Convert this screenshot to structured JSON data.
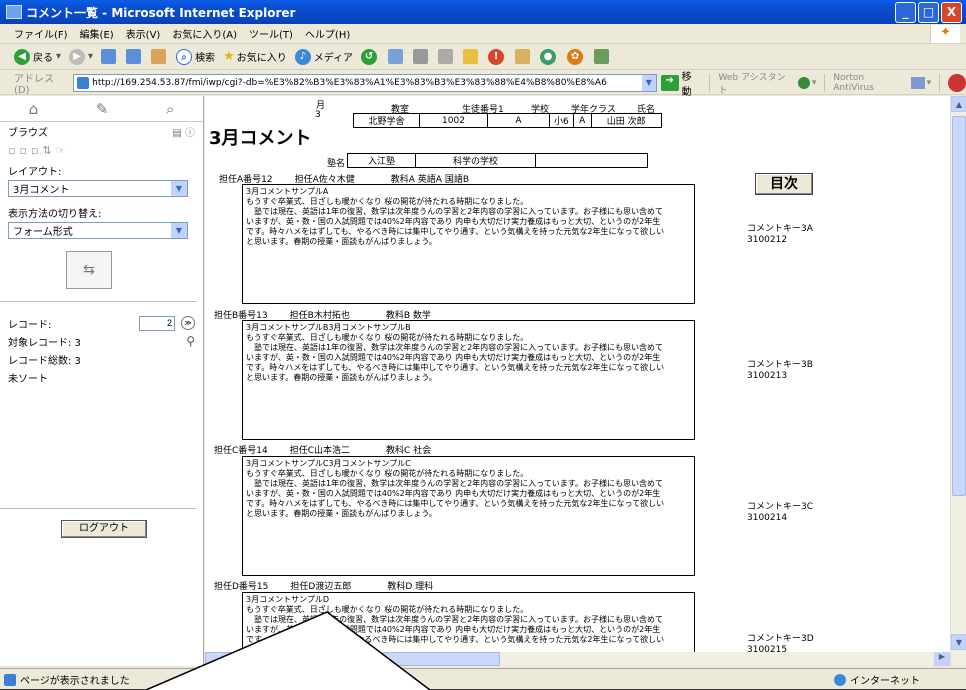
{
  "window": {
    "title": "コメント一覧 - Microsoft Internet Explorer",
    "minimize": "_",
    "maximize": "□",
    "close": "X"
  },
  "menu": [
    "ファイル(F)",
    "編集(E)",
    "表示(V)",
    "お気に入り(A)",
    "ツール(T)",
    "ヘルプ(H)"
  ],
  "toolbar": {
    "back": "戻る",
    "search": "検索",
    "favorites": "お気に入り",
    "media": "メディア"
  },
  "address": {
    "label": "アドレス(D)",
    "url": "http://169.254.53.87/fmi/iwp/cgi?-db=%E3%82%B3%E3%83%A1%E3%83%B3%E3%83%88%E4%B8%80%E8%A6",
    "go": "移動",
    "web_assistant": "Web アシスタント",
    "norton": "Norton AntiVirus"
  },
  "left": {
    "browse": "ブラウズ",
    "layout_label": "レイアウト:",
    "layout_value": "3月コメント",
    "view_label": "表示方法の切り替え:",
    "view_value": "フォーム形式",
    "record_label": "レコード:",
    "record_value": "2",
    "found_label": "対象レコード: 3",
    "total_label": "レコード総数: 3",
    "unsorted": "未ソート",
    "logout": "ログアウト"
  },
  "content": {
    "page_title": "3月コメント",
    "month_label": "月",
    "month_value": "3",
    "class_label": "教室",
    "class_value": "北野学舎",
    "student_no_label": "生徒番号1",
    "student_no_value": "1002",
    "school_label": "学校",
    "school_value": "A",
    "grade_class_label": "学年クラス",
    "grade_value": "小6",
    "class_letter": "A",
    "name_label": "氏名",
    "name_value": "山田 次郎",
    "juku_label": "塾名",
    "juku_value": "入江塾",
    "aim_value": "科学の学校",
    "toc": "目次"
  },
  "sections": [
    {
      "teacher_no": "担任A番号12",
      "teacher": "担任A佐々木健",
      "subject": "教科A 英語A 国語B",
      "comment": [
        "3月コメントサンプルA",
        "もうすぐ卒業式、日ざしも暖かくなり 桜の開花が待たれる時期になりました。",
        "　塾では現在、英語は1年の復習、数学は次年度うんの学習と2年内容の学習に入っています。お子様にも思い含めて",
        "いますが、英・数・国の入試問題では40%2年内容であり 内申も大切だけ実力養成はもっと大切、というのが2年生",
        "です。時々ハメをはずしても、やるべき時には集中してやり通す、という気構えを持った元気な2年生になって欲しい",
        "と思います。春期の授業・面談もがんばりましょう。"
      ],
      "key": "コメントキー3A",
      "key_no": "3100212"
    },
    {
      "teacher_no": "担任B番号13",
      "teacher": "担任B木村拓也",
      "subject": "教科B 数学",
      "comment": [
        "3月コメントサンプルB3月コメントサンプルB",
        "もうすぐ卒業式、日ざしも暖かくなり 桜の開花が待たれる時期になりました。",
        "　塾では現在、英語は1年の復習、数学は次年度うんの学習と2年内容の学習に入っています。お子様にも思い含めて",
        "いますが、英・数・国の入試問題では40%2年内容であり 内申も大切だけ実力養成はもっと大切、というのが2年生",
        "です。時々ハメをはずしても、やるべき時には集中してやり通す、という気構えを持った元気な2年生になって欲しい",
        "と思います。春期の授業・面談もがんばりましょう。"
      ],
      "key": "コメントキー3B",
      "key_no": "3100213"
    },
    {
      "teacher_no": "担任C番号14",
      "teacher": "担任C山本浩二",
      "subject": "教科C 社会",
      "comment": [
        "3月コメントサンプルC3月コメントサンプルC",
        "もうすぐ卒業式、日ざしも暖かくなり 桜の開花が待たれる時期になりました。",
        "　塾では現在、英語は1年の復習、数学は次年度うんの学習と2年内容の学習に入っています。お子様にも思い含めて",
        "いますが、英・数・国の入試問題では40%2年内容であり 内申も大切だけ実力養成はもっと大切、というのが2年生",
        "です。時々ハメをはずしても、やるべき時には集中してやり通す、という気構えを持った元気な2年生になって欲しい",
        "と思います。春期の授業・面談もがんばりましょう。"
      ],
      "key": "コメントキー3C",
      "key_no": "3100214"
    },
    {
      "teacher_no": "担任D番号15",
      "teacher": "担任D渡辺五郎",
      "subject": "教科D 理科",
      "comment": [
        "3月コメントサンプルD",
        "もうすぐ卒業式、日ざしも暖かくなり 桜の開花が待たれる時期になりました。",
        "　塾では現在、英語は1年の復習、数学は次年度うんの学習と2年内容の学習に入っています。お子様にも思い含めて",
        "いますが、英・数・国の入試問題では40%2年内容であり 内申も大切だけ実力養成はもっと大切、というのが2年生",
        "です。時々ハメをはずしても、やるべき時には集中してやり通す、という気構えを持った元気な2年生になって欲しい"
      ],
      "key": "コメントキー3D",
      "key_no": "3100215"
    }
  ],
  "status": {
    "text": "ページが表示されました",
    "zone": "インターネット"
  },
  "colors": {
    "titlebar": "#0a4fd0",
    "accent": "#c1d3fb"
  }
}
